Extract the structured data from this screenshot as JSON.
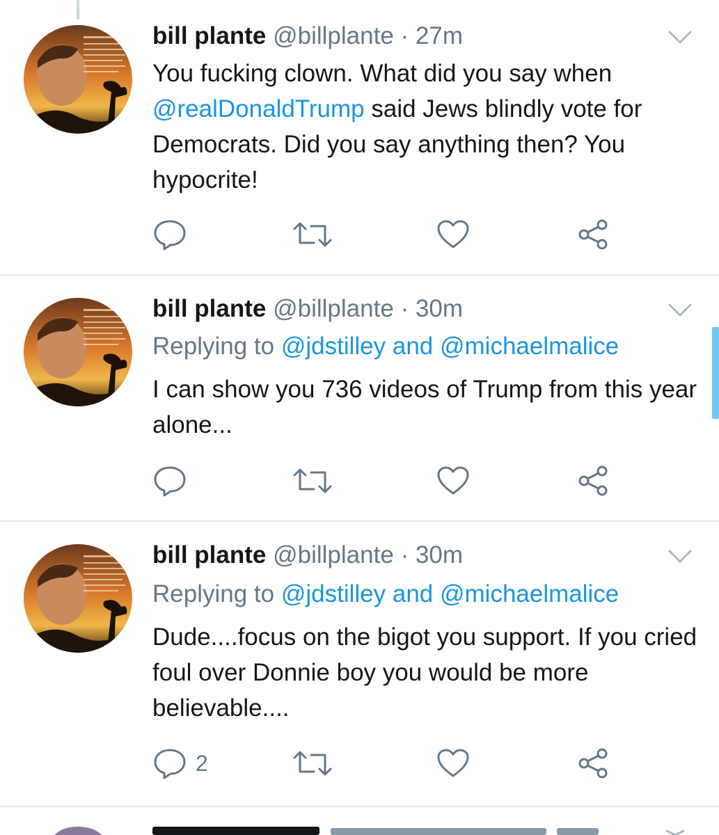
{
  "colors": {
    "link": "#1b95e0",
    "secondary_text": "#657786",
    "divider": "#e6ecf0",
    "scrollbar": "#71c9f8"
  },
  "tweets": [
    {
      "name": "bill plante",
      "handle": "@billplante",
      "dot": "·",
      "time": "27m",
      "body_parts": [
        "You fucking clown. What did you say when ",
        "@realDonaldTrump",
        " said Jews blindly vote for Democrats. Did you say anything then? You hypocrite!"
      ],
      "reply_count": ""
    },
    {
      "name": "bill plante",
      "handle": "@billplante",
      "dot": "·",
      "time": "30m",
      "replying_prefix": "Replying to ",
      "replying_user1": "@jdstilley",
      "replying_and": " and ",
      "replying_user2": "@michaelmalice",
      "body": "I can show you 736 videos of Trump from this year alone...",
      "reply_count": ""
    },
    {
      "name": "bill plante",
      "handle": "@billplante",
      "dot": "·",
      "time": "30m",
      "replying_prefix": "Replying to ",
      "replying_user1": "@jdstilley",
      "replying_and": " and ",
      "replying_user2": "@michaelmalice",
      "body": "Dude....focus on the bigot you support. If you cried foul over Donnie boy you would be more believable....",
      "reply_count": "2"
    }
  ],
  "icons": {
    "reply": "reply-bubble-icon",
    "retweet": "retweet-arrows-icon",
    "like": "heart-icon",
    "share": "share-nodes-icon",
    "menu": "chevron-down-icon"
  }
}
